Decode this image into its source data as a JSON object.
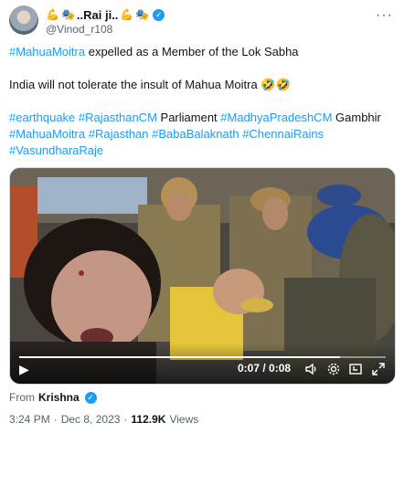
{
  "author": {
    "display_name": "..Rai ji..",
    "emoji_lead": "💪",
    "emoji_masks": "🎭",
    "emoji_mid": "💪",
    "emoji_tail": "🎭",
    "handle": "@Vinod_r108"
  },
  "more_label": "···",
  "tweet": {
    "line1_tag": "#MahuaMoitra",
    "line1_text": " expelled as a Member of the Lok Sabha",
    "line2_text": "India will not tolerate the insult of Mahua Moitra ",
    "line2_emoji": "🤣🤣",
    "tags": {
      "t1": "#earthquake",
      "t2": "#RajasthanCM",
      "plain1": " Parliament ",
      "t3": "#MadhyaPradeshCM",
      "plain2": " Gambhir",
      "t4": "#MahuaMoitra",
      "t5": "#Rajasthan",
      "t6": "#BabaBalaknath",
      "t7": "#ChennaiRains",
      "t8": "#VasundharaRaje"
    }
  },
  "video": {
    "time": "0:07 / 0:08",
    "progress": 0.875,
    "play_icon": "▶",
    "volume_icon": "🔈",
    "settings_icon": "⚙",
    "pip_icon": "⧉",
    "fullscreen_icon": "⤢"
  },
  "source": {
    "label": "From",
    "name": "Krishna"
  },
  "meta": {
    "time": "3:24 PM",
    "sep": "·",
    "date": "Dec 8, 2023",
    "sep2": "·",
    "views": "112.9K",
    "views_label": "Views"
  },
  "colors": {
    "accent": "#1d9bf0",
    "text": "#0f1419",
    "muted": "#536471"
  }
}
